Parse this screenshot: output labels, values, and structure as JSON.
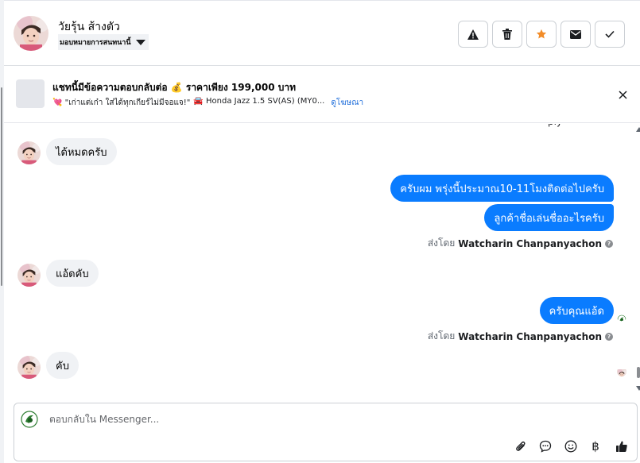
{
  "header": {
    "contact_name": "วัยรุ้น ส้างตัว",
    "assign_label": "มอบหมายการสนทนานี้",
    "actions": [
      {
        "name": "report-button",
        "icon": "warning-icon"
      },
      {
        "name": "delete-button",
        "icon": "trash-icon"
      },
      {
        "name": "star-button",
        "icon": "star-icon"
      },
      {
        "name": "mark-unread-button",
        "icon": "envelope-icon"
      },
      {
        "name": "mark-done-button",
        "icon": "check-icon"
      }
    ]
  },
  "banner": {
    "title": "แชทนี้มีข้อความตอบกลับต่อ 💰 ราคาเพียง 199,000 บาท",
    "subtitle_quote": "💘 \"เก่าแต่เก๋า ใส่ได้ทุกเกียร์ไม่มีจอแจ!\"",
    "subtitle_car": "🚘 Honda Jazz 1.5 SV(AS) (MY0...",
    "view_ad_link": "ดูโฆษณา"
  },
  "messages": {
    "cut_text": "ply",
    "in_1": "ได้หมดครับ",
    "out_1": "ครับผม พรุ่งนี้ประมาณ10-11โมงติดต่อไปครับ",
    "out_2": "ลูกค้าชื่อเล่นชื่ออะไรครับ",
    "sent_by_1_prefix": "ส่งโดย",
    "sent_by_1_name": "Watcharin Chanpanyachon",
    "in_2": "แอ้ดคับ",
    "out_3": "ครับคุณแอ้ด",
    "sent_by_2_prefix": "ส่งโดย",
    "sent_by_2_name": "Watcharin Chanpanyachon",
    "in_3": "คับ"
  },
  "composer": {
    "placeholder": "ตอบกลับใน Messenger...",
    "baht_symbol": "฿"
  },
  "colors": {
    "outgoing_bubble": "#0a7cff",
    "incoming_bubble": "#f0f2f5",
    "star": "#f28c28",
    "link": "#216fdb"
  }
}
